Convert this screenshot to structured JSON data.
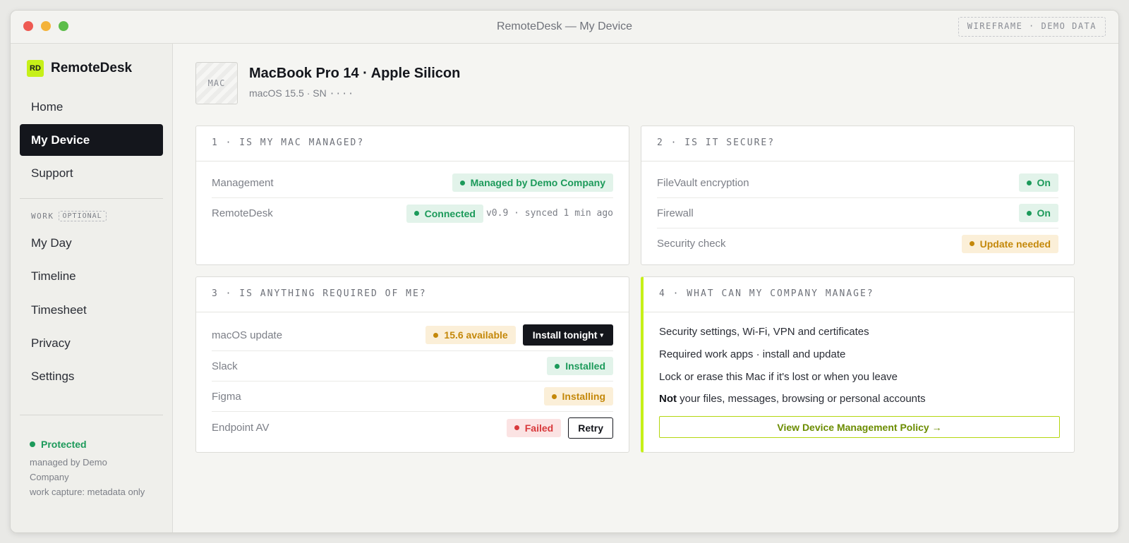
{
  "window": {
    "title": "RemoteDesk — My Device",
    "badge": "WIREFRAME · DEMO DATA"
  },
  "sidebar": {
    "logo_text": "RD",
    "brand": "RemoteDesk",
    "primary_items": [
      {
        "label": "Home",
        "active": false
      },
      {
        "label": "My Device",
        "active": true
      },
      {
        "label": "Support",
        "active": false
      }
    ],
    "work_section": {
      "label": "WORK",
      "badge": "OPTIONAL",
      "items": [
        {
          "label": "My Day"
        },
        {
          "label": "Timeline"
        },
        {
          "label": "Timesheet"
        },
        {
          "label": "Privacy"
        },
        {
          "label": "Settings"
        }
      ]
    },
    "status": {
      "label": "Protected",
      "line1": "managed by Demo",
      "line2": "Company",
      "line3": "work capture: metadata only"
    }
  },
  "device": {
    "thumb_label": "MAC",
    "name": "MacBook Pro 14 · Apple Silicon",
    "os": "macOS 15.5 · SN",
    "serial_masked": "····"
  },
  "cards": {
    "managed": {
      "title": "1 · IS MY MAC MANAGED?",
      "rows": [
        {
          "label": "Management",
          "status": "Managed by Demo Company"
        },
        {
          "label": "RemoteDesk",
          "status": "Connected",
          "note": "v0.9 · synced 1 min ago"
        }
      ]
    },
    "secure": {
      "title": "2 · IS IT SECURE?",
      "rows": [
        {
          "label": "FileVault encryption",
          "status": "On"
        },
        {
          "label": "Firewall",
          "status": "On"
        },
        {
          "label": "Security check",
          "status": "Update needed"
        }
      ]
    },
    "required": {
      "title": "3 · IS ANYTHING REQUIRED OF ME?",
      "rows": [
        {
          "label": "macOS update",
          "status": "15.6 available",
          "action": "Install tonight",
          "action_caret": "▾"
        },
        {
          "label": "Slack",
          "status": "Installed"
        },
        {
          "label": "Figma",
          "status": "Installing"
        },
        {
          "label": "Endpoint AV",
          "status": "Failed",
          "action": "Retry"
        }
      ]
    },
    "company": {
      "title": "4 · WHAT CAN MY COMPANY MANAGE?",
      "lines": [
        "Security settings, Wi-Fi, VPN and certificates",
        "Required work apps · install and update",
        "Lock or erase this Mac if it's lost or when you leave"
      ],
      "not_prefix": "Not",
      "not_rest": " your files, messages, browsing or personal accounts",
      "policy_button": "View Device Management Policy →"
    }
  },
  "colors": {
    "accent": "#c6f018",
    "dark": "#14161c",
    "green": "#1c9a5a",
    "amber": "#c4880a",
    "red": "#d8393b"
  }
}
